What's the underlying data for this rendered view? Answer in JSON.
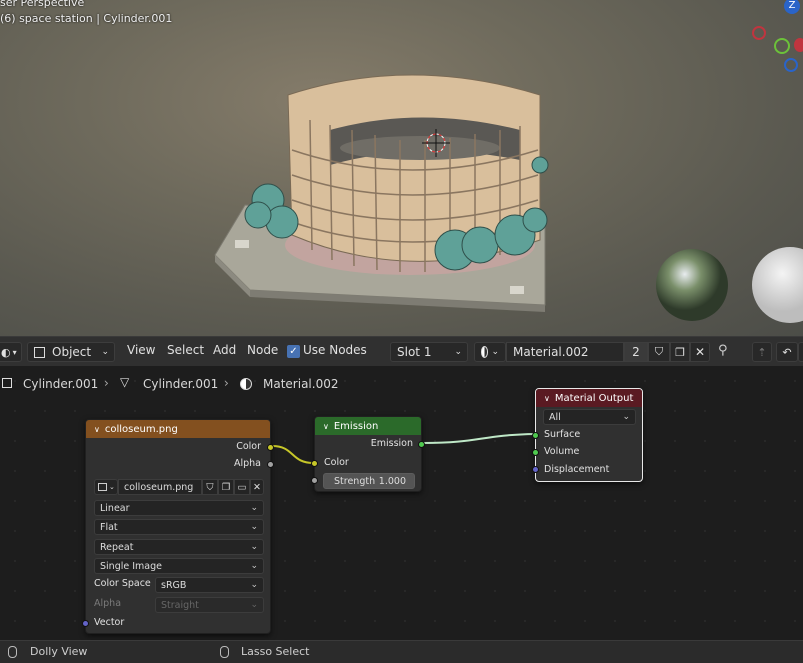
{
  "viewport": {
    "view_label": "ser Perspective",
    "object_info": "(6) space station | Cylinder.001",
    "gizmo_axis": "Z"
  },
  "header": {
    "mode": "Object",
    "menus": [
      "View",
      "Select",
      "Add",
      "Node"
    ],
    "use_nodes_label": "Use Nodes",
    "slot": "Slot 1",
    "material_name": "Material.002",
    "user_count": "2"
  },
  "breadcrumbs": [
    "Cylinder.001",
    "Cylinder.001",
    "Material.002"
  ],
  "nodes": {
    "image": {
      "title": "colloseum.png",
      "outputs": [
        "Color",
        "Alpha"
      ],
      "image_name": "colloseum.png",
      "interpolation": "Linear",
      "projection": "Flat",
      "extension": "Repeat",
      "source": "Single Image",
      "color_space_label": "Color Space",
      "color_space": "sRGB",
      "alpha_label": "Alpha",
      "alpha_mode": "Straight",
      "input": "Vector"
    },
    "emission": {
      "title": "Emission",
      "output": "Emission",
      "input_color": "Color",
      "strength_label": "Strength",
      "strength_value": "1.000"
    },
    "output": {
      "title": "Material Output",
      "target": "All",
      "inputs": [
        "Surface",
        "Volume",
        "Displacement"
      ]
    }
  },
  "status": {
    "left": "Dolly View",
    "right": "Lasso Select"
  },
  "colors": {
    "image_header": "#83501f",
    "emission_header": "#2b6a2a",
    "output_header": "#5a1a22",
    "socket_color": "#c7c729",
    "socket_shader": "#4fc94f",
    "socket_vector": "#6363c7",
    "socket_float": "#a1a1a1"
  }
}
